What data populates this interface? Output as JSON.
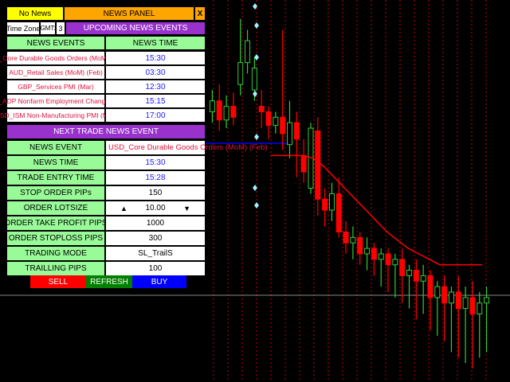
{
  "panel": {
    "no_news": "No News",
    "title": "NEWS PANEL",
    "close": "X",
    "timezone_label": "Time Zone",
    "gmt_label": "GMT:",
    "gmt_value": "3",
    "upcoming_header": "UPCOMING NEWS EVENTS",
    "col_events": "NEWS EVENTS",
    "col_time": "NEWS TIME",
    "events": [
      {
        "name": "USD_Core Durable Goods Orders (MoM) (Feb)",
        "time": "15:30"
      },
      {
        "name": "AUD_Retail Sales (MoM) (Feb)",
        "time": "03:30"
      },
      {
        "name": "GBP_Services PMI (Mar)",
        "time": "12:30"
      },
      {
        "name": "USD_ADP Nonfarm Employment Change (Mar)",
        "time": "15:15"
      },
      {
        "name": "USD_ISM Non-Manufacturing PMI (Mar)",
        "time": "17:00"
      }
    ],
    "next_header": "NEXT TRADE NEWS EVENT",
    "next": {
      "event_label": "NEWS EVENT",
      "event_value": "USD_Core Durable Goods Orders (MoM) (Feb)",
      "time_label": "NEWS TIME",
      "time_value": "15:30",
      "entry_label": "TRADE ENTRY TIME",
      "entry_value": "15:28",
      "stop_pips_label": "STOP ORDER PIPs",
      "stop_pips_value": "150",
      "lot_label": "ORDER LOTSIZE",
      "lot_value": "10.00",
      "tp_label": "ORDER TAKE PROFIT PIPS",
      "tp_value": "1000",
      "sl_label": "ORDER STOPLOSS PIPS",
      "sl_value": "300",
      "mode_label": "TRADING MODE",
      "mode_value": "SL_TrailS",
      "trail_label": "TRAILLING PIPS",
      "trail_value": "100"
    },
    "sell": "SELL",
    "refresh": "REFRESH",
    "buy": "BUY"
  },
  "colors": {
    "bull": "#32cd32",
    "bear": "#ff0000",
    "doji_fill": "#ffffff",
    "trail_line": "#ff0000",
    "blue_line": "#0000ff",
    "separator": "#ff0000",
    "price_line": "#c0c0c0"
  },
  "chart_data": {
    "type": "candlestick",
    "y_range": [
      0,
      100
    ],
    "candles": [
      {
        "o": 62,
        "c": 66,
        "h": 70,
        "l": 58
      },
      {
        "o": 66,
        "c": 59,
        "h": 72,
        "l": 55
      },
      {
        "o": 59,
        "c": 64,
        "h": 68,
        "l": 56
      },
      {
        "o": 64,
        "c": 60,
        "h": 69,
        "l": 57
      },
      {
        "o": 72,
        "c": 80,
        "h": 96,
        "l": 68
      },
      {
        "o": 80,
        "c": 88,
        "h": 92,
        "l": 76
      },
      {
        "o": 70,
        "c": 78,
        "h": 82,
        "l": 66
      },
      {
        "o": 64,
        "c": 62,
        "h": 70,
        "l": 56
      },
      {
        "o": 62,
        "c": 57,
        "h": 64,
        "l": 52
      },
      {
        "o": 57,
        "c": 60,
        "h": 62,
        "l": 54
      },
      {
        "o": 60,
        "c": 54,
        "h": 92,
        "l": 48
      },
      {
        "o": 50,
        "c": 58,
        "h": 66,
        "l": 45
      },
      {
        "o": 58,
        "c": 52,
        "h": 62,
        "l": 38
      },
      {
        "o": 46,
        "c": 40,
        "h": 52,
        "l": 36
      },
      {
        "o": 34,
        "c": 56,
        "h": 58,
        "l": 32
      },
      {
        "o": 55,
        "c": 30,
        "h": 60,
        "l": 24
      },
      {
        "o": 30,
        "c": 26,
        "h": 34,
        "l": 20
      },
      {
        "o": 26,
        "c": 32,
        "h": 36,
        "l": 22
      },
      {
        "o": 32,
        "c": 18,
        "h": 38,
        "l": 16
      },
      {
        "o": 18,
        "c": 14,
        "h": 22,
        "l": 10
      },
      {
        "o": 14,
        "c": 16,
        "h": 20,
        "l": 8
      },
      {
        "o": 16,
        "c": 10,
        "h": 18,
        "l": 6
      },
      {
        "o": 10,
        "c": 12,
        "h": 16,
        "l": 4
      },
      {
        "o": 12,
        "c": 8,
        "h": 14,
        "l": 2
      },
      {
        "o": 8,
        "c": 10,
        "h": 12,
        "l": -2
      },
      {
        "o": 10,
        "c": 6,
        "h": 12,
        "l": -4
      },
      {
        "o": 6,
        "c": 8,
        "h": 10,
        "l": -6
      },
      {
        "o": 8,
        "c": 2,
        "h": 12,
        "l": -8
      },
      {
        "o": 2,
        "c": 4,
        "h": 6,
        "l": -10
      },
      {
        "o": 4,
        "c": 0,
        "h": 8,
        "l": -14
      },
      {
        "o": 0,
        "c": 2,
        "h": 6,
        "l": -12
      },
      {
        "o": 2,
        "c": -6,
        "h": 4,
        "l": -18
      },
      {
        "o": -6,
        "c": -2,
        "h": 0,
        "l": -20
      },
      {
        "o": -2,
        "c": -8,
        "h": 2,
        "l": -22
      },
      {
        "o": -8,
        "c": -4,
        "h": -2,
        "l": -26
      },
      {
        "o": -4,
        "c": -10,
        "h": 2,
        "l": -28
      },
      {
        "o": -10,
        "c": -6,
        "h": -2,
        "l": -30
      },
      {
        "o": -6,
        "c": -12,
        "h": 0,
        "l": -32
      },
      {
        "o": -12,
        "c": -8,
        "h": -4,
        "l": -28
      },
      {
        "o": -8,
        "c": -6,
        "h": -2,
        "l": -26
      }
    ],
    "trail": [
      46,
      46,
      46,
      46,
      45,
      42,
      38,
      34,
      30,
      26,
      22,
      18,
      15,
      12,
      10,
      8,
      6,
      6,
      6,
      6,
      6
    ],
    "separators": 20
  }
}
